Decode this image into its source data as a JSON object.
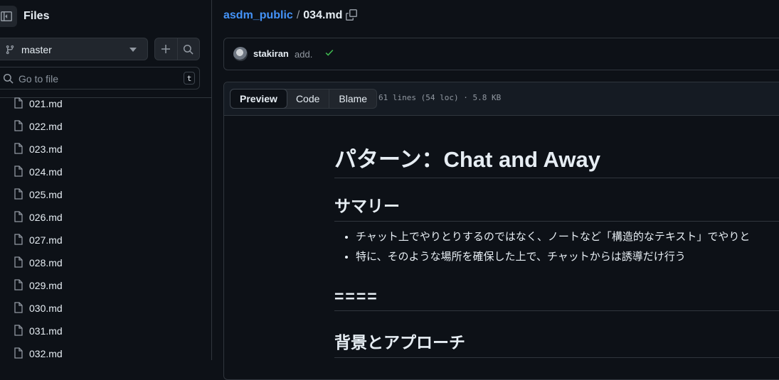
{
  "sidebar": {
    "title": "Files",
    "branch": "master",
    "goto_placeholder": "Go to file",
    "goto_shortcut": "t",
    "files": [
      "021.md",
      "022.md",
      "023.md",
      "024.md",
      "025.md",
      "026.md",
      "027.md",
      "028.md",
      "029.md",
      "030.md",
      "031.md",
      "032.md"
    ]
  },
  "breadcrumb": {
    "repo": "asdm_public",
    "separator": "/",
    "file": "034.md"
  },
  "commit": {
    "author": "stakiran",
    "message": "add.",
    "status_color": "#3fb950"
  },
  "file_header": {
    "tabs": [
      "Preview",
      "Code",
      "Blame"
    ],
    "meta": "61 lines (54 loc) · 5.8 KB"
  },
  "markdown": {
    "h1": "パターン：Chat and Away",
    "h2_summary": "サマリー",
    "bullets": [
      "チャット上でやりとりするのではなく、ノートなど「構造的なテキスト」でやりと",
      "特に、そのような場所を確保した上で、チャットからは誘導だけ行う"
    ],
    "h2_separator": "====",
    "h2_background": "背景とアプローチ"
  },
  "colors": {
    "link": "#4493f8",
    "background": "#0d1117",
    "border": "#30363d"
  }
}
